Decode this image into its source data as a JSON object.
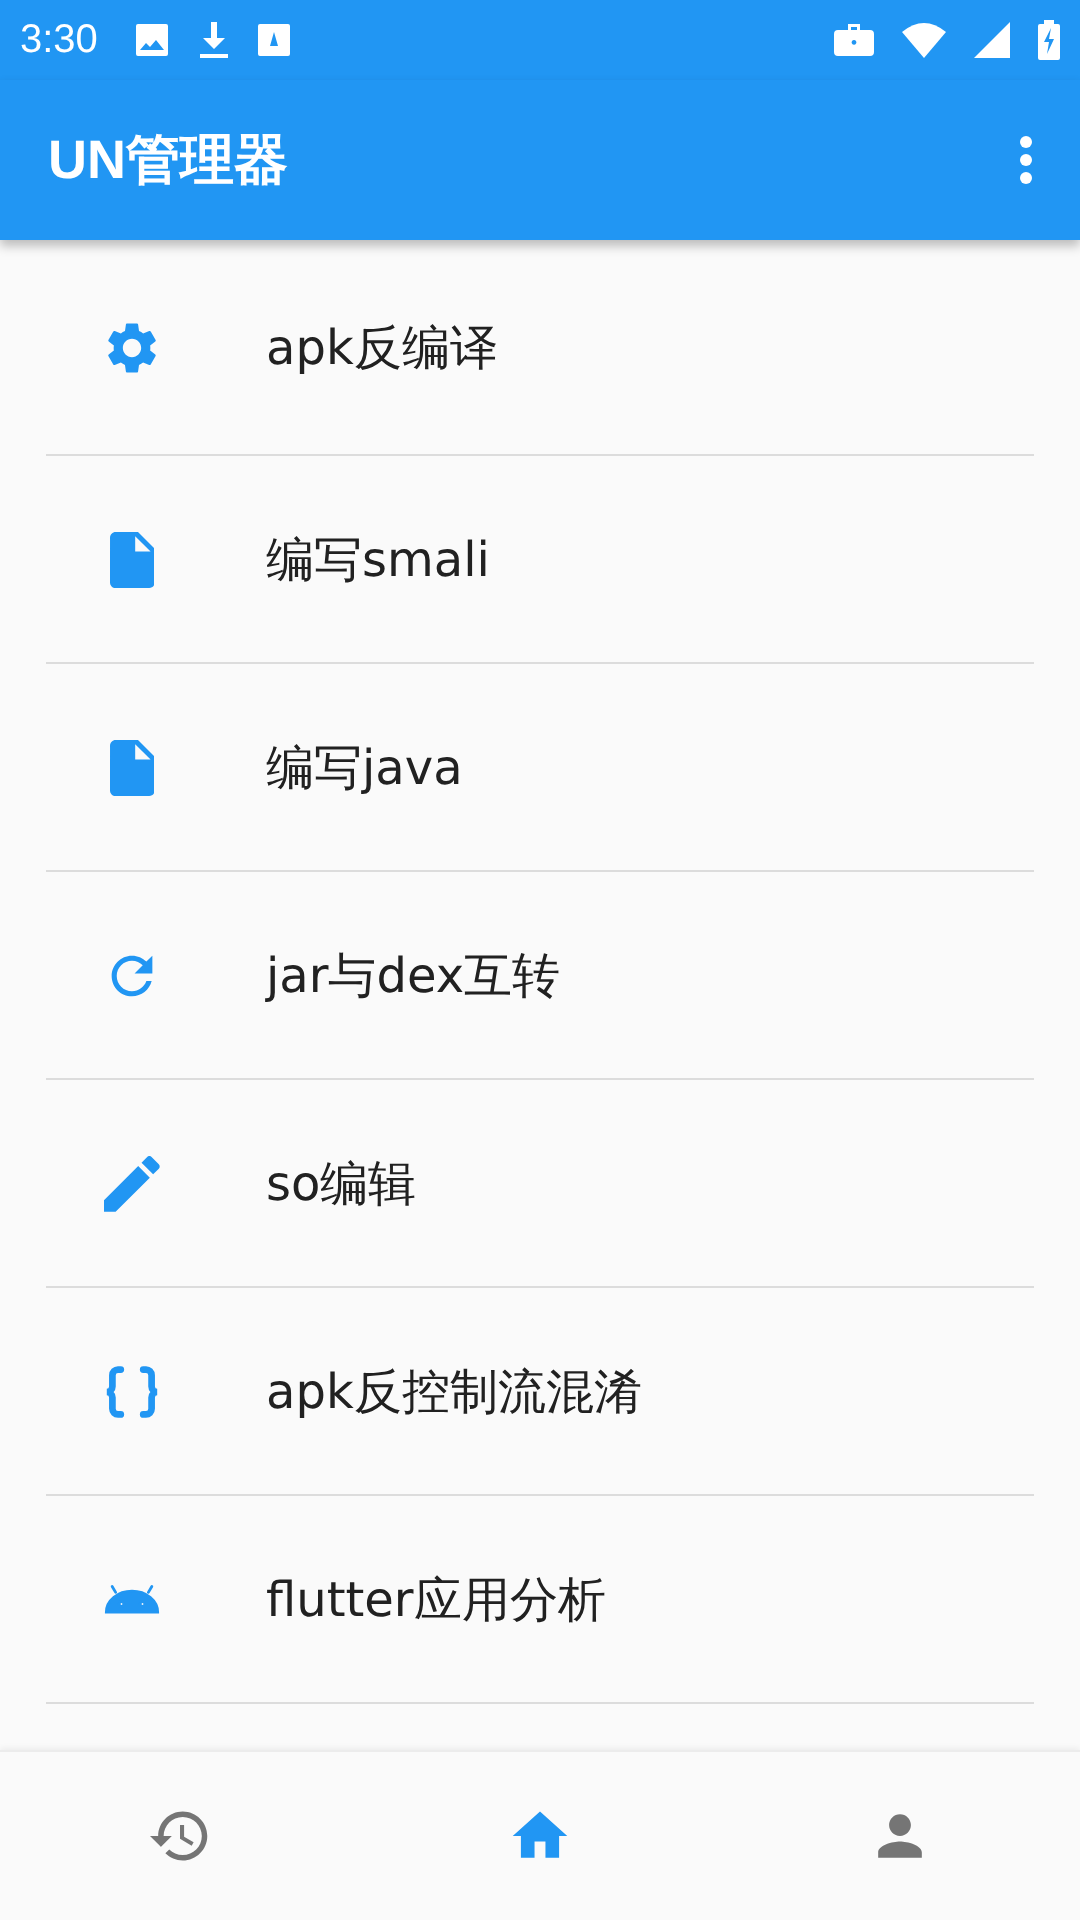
{
  "status_bar": {
    "time": "3:30"
  },
  "app_bar": {
    "title": "UN管理器"
  },
  "items": [
    {
      "label": "apk反编译",
      "kind": "gear"
    },
    {
      "label": "编写smali",
      "kind": "file"
    },
    {
      "label": "编写java",
      "kind": "file"
    },
    {
      "label": "jar与dex互转",
      "kind": "refresh"
    },
    {
      "label": "so编辑",
      "kind": "pencil"
    },
    {
      "label": "apk反控制流混淆",
      "kind": "braces"
    },
    {
      "label": "flutter应用分析",
      "kind": "android"
    }
  ],
  "bottom_nav": [
    {
      "kind": "history",
      "selected": false
    },
    {
      "kind": "home",
      "selected": true
    },
    {
      "kind": "person",
      "selected": false
    }
  ]
}
